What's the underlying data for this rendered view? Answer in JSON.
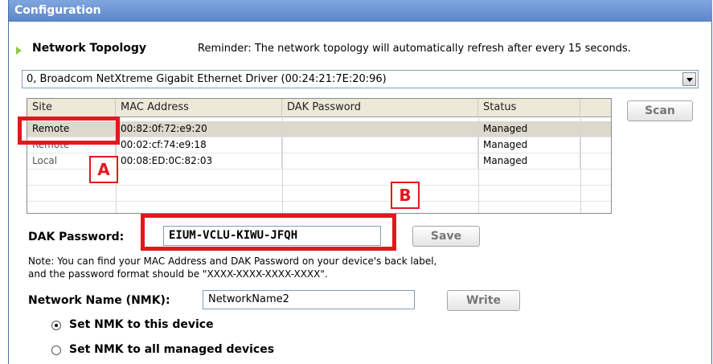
{
  "window": {
    "title": "Configuration"
  },
  "topology": {
    "title": "Network Topology",
    "reminder": "Reminder: The network topology will automatically refresh after every 15 seconds."
  },
  "adapter_select": {
    "value": "0, Broadcom NetXtreme Gigabit Ethernet Driver (00:24:21:7E:20:96)"
  },
  "table": {
    "headers": [
      "Site",
      "MAC Address",
      "DAK Password",
      "Status"
    ],
    "rows": [
      {
        "site": "Remote",
        "mac": "00:82:0f:72:e9:20",
        "dak": "",
        "status": "Managed",
        "selected": true
      },
      {
        "site": "Remote",
        "mac": "00:02:cf:74:e9:18",
        "dak": "",
        "status": "Managed",
        "selected": false
      },
      {
        "site": "Local",
        "mac": "00:08:ED:0C:82:03",
        "dak": "",
        "status": "Managed",
        "selected": false
      }
    ]
  },
  "buttons": {
    "scan": "Scan",
    "save": "Save",
    "write": "Write"
  },
  "dak": {
    "label": "DAK Password:",
    "value": "EIUM-VCLU-KIWU-JFQH"
  },
  "note": {
    "line1": "Note: You can find your MAC Address and DAK Password on your device's back label,",
    "line2": "and the password format should be \"XXXX-XXXX-XXXX-XXXX\"."
  },
  "nmk": {
    "label": "Network Name (NMK):",
    "value": "NetworkName2",
    "options": [
      {
        "label": "Set NMK to this device",
        "checked": true
      },
      {
        "label": "Set NMK to all managed devices",
        "checked": false
      }
    ]
  },
  "callouts": {
    "a": "A",
    "b": "B"
  },
  "colors": {
    "highlight": "#e3171c",
    "titlebar": "#5c86c9",
    "accent_arrow": "#8ec63f"
  }
}
